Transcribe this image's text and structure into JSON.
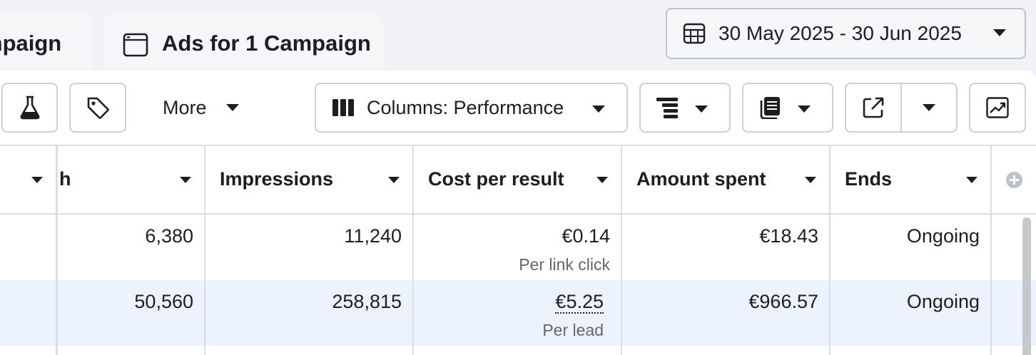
{
  "tabs": [
    {
      "label": "mpaign",
      "icon": "none"
    },
    {
      "label": "Ads for 1 Campaign",
      "icon": "ad-window-icon"
    }
  ],
  "date_range": {
    "label": "30 May 2025 - 30 Jun 2025",
    "icon": "calendar-icon"
  },
  "toolbar": {
    "more_label": "More",
    "columns_label": "Columns: Performance",
    "icons": [
      "flask-icon",
      "tag-icon",
      "breakdown-icon",
      "reports-icon",
      "export-icon",
      "chart-icon"
    ]
  },
  "table": {
    "headers": [
      "",
      "h",
      "Impressions",
      "Cost per result",
      "Amount spent",
      "Ends"
    ],
    "rows": [
      {
        "reach": "6,380",
        "impressions": "11,240",
        "cost": "€0.14",
        "cost_sub": "Per link click",
        "spent": "€18.43",
        "ends": "Ongoing"
      },
      {
        "reach": "50,560",
        "impressions": "258,815",
        "cost": "€5.25",
        "cost_sub": "Per lead",
        "spent": "€966.57",
        "ends": "Ongoing"
      }
    ]
  },
  "colors": {
    "row_highlight": "#ecf3ff",
    "border": "#dadde1",
    "text": "#1c1e21",
    "muted": "#65676b"
  }
}
